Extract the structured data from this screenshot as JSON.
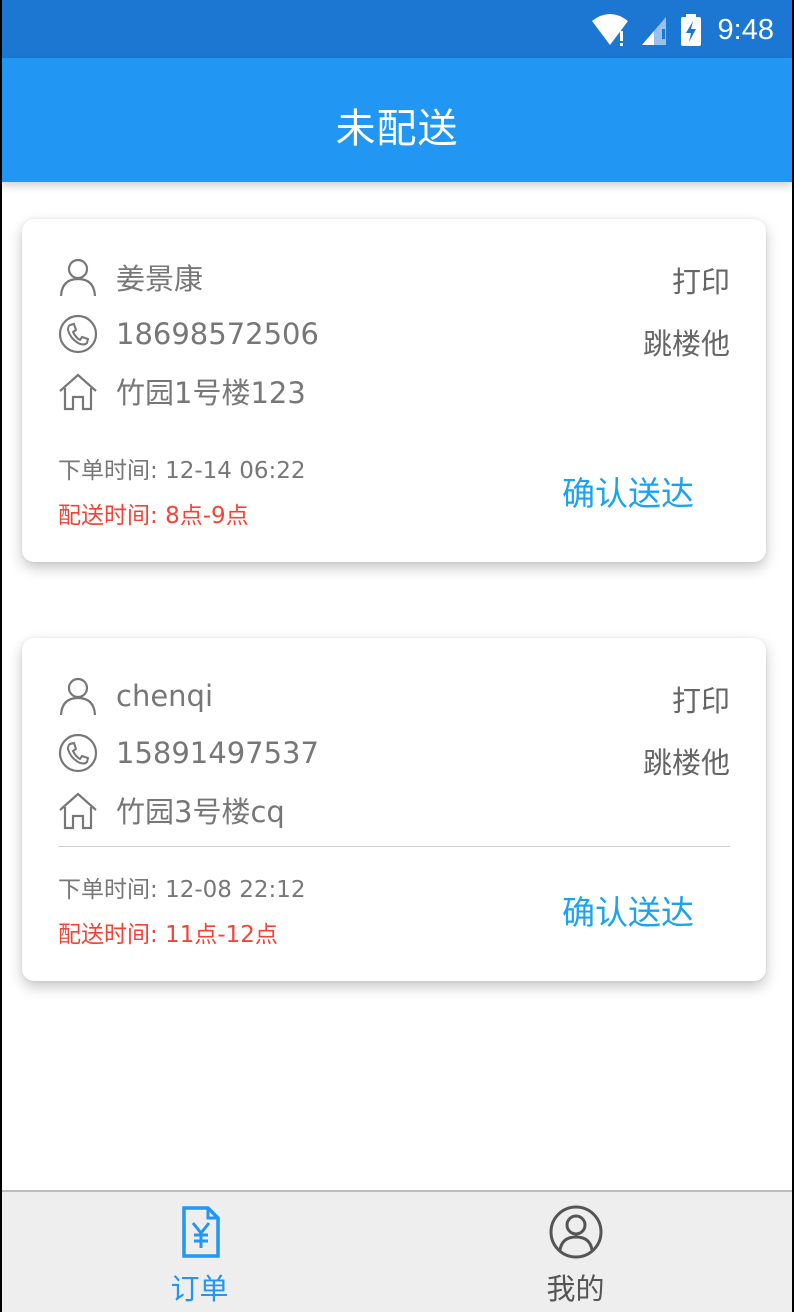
{
  "status_bar": {
    "time": "9:48"
  },
  "app_bar": {
    "title": "未配送"
  },
  "orders": [
    {
      "name": "姜景康",
      "phone": "18698572506",
      "address": "竹园1号楼123",
      "print_label": "打印",
      "floor_label": "跳楼他",
      "order_time_label": "下单时间:",
      "order_time": "12-14 06:22",
      "delivery_time_label": "配送时间:",
      "delivery_time": "8点-9点",
      "confirm_label": "确认送达"
    },
    {
      "name": "chenqi",
      "phone": "15891497537",
      "address": "竹园3号楼cq",
      "print_label": "打印",
      "floor_label": "跳楼他",
      "order_time_label": "下单时间:",
      "order_time": "12-08 22:12",
      "delivery_time_label": "配送时间:",
      "delivery_time": "11点-12点",
      "confirm_label": "确认送达"
    }
  ],
  "tab_bar": {
    "tabs": [
      {
        "label": "订单",
        "icon": "order-yen-icon",
        "active": true
      },
      {
        "label": "我的",
        "icon": "profile-icon",
        "active": false
      }
    ],
    "active_color": "#2196f3",
    "inactive_color": "#555555"
  },
  "colors": {
    "status_bar": "#1b77d2",
    "app_bar": "#2196f3",
    "delivery_time": "#f44336",
    "confirm": "#1ba3f2"
  }
}
